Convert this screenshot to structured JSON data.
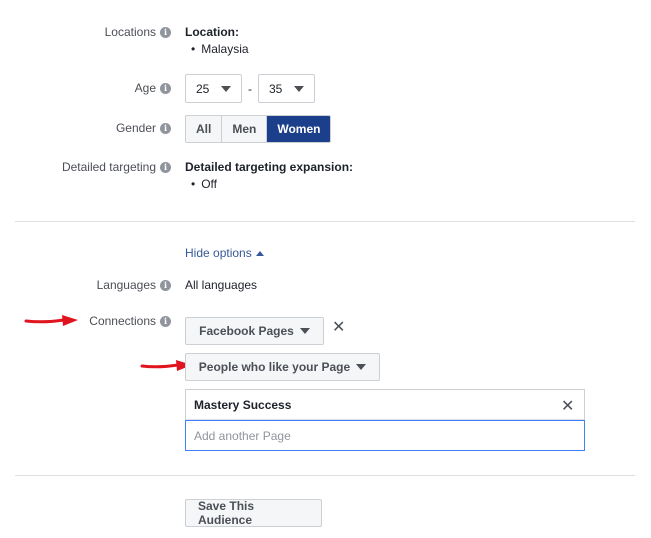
{
  "locations": {
    "label": "Locations",
    "heading": "Location:",
    "items": [
      "Malaysia"
    ]
  },
  "age": {
    "label": "Age",
    "min": "25",
    "separator": "-",
    "max": "35"
  },
  "gender": {
    "label": "Gender",
    "options": [
      "All",
      "Men",
      "Women"
    ],
    "selected": "Women"
  },
  "detailed_targeting": {
    "label": "Detailed targeting",
    "heading": "Detailed targeting expansion:",
    "items": [
      "Off"
    ]
  },
  "hide_options": {
    "label": "Hide options"
  },
  "languages": {
    "label": "Languages",
    "value": "All languages"
  },
  "connections": {
    "label": "Connections",
    "type_dropdown": "Facebook Pages",
    "condition_dropdown": "People who like your Page",
    "selected_page": "Mastery Success",
    "add_page_placeholder": "Add another Page"
  },
  "save_button": "Save This Audience",
  "colors": {
    "arrow": "#e0141e",
    "selected": "#1b3f8a",
    "link": "#365899",
    "input_focus": "#4080ff"
  }
}
